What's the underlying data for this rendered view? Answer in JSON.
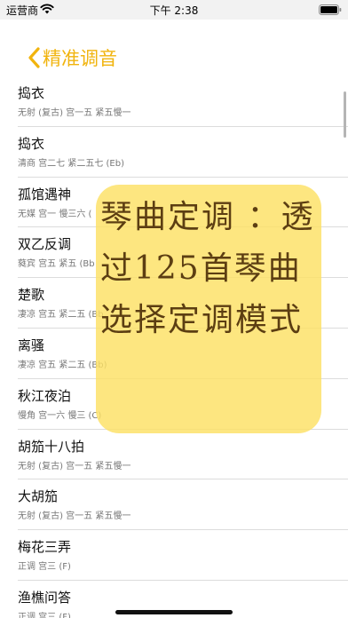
{
  "status_bar": {
    "carrier": "运营商",
    "time": "下午 2:38"
  },
  "nav": {
    "back_label": "精准调音"
  },
  "list": [
    {
      "title": "捣衣",
      "sub": "无射 (复古) 宫一五 紧五慢一"
    },
    {
      "title": "捣衣",
      "sub": "清商 宫二七 紧二五七 (Eb)"
    },
    {
      "title": "孤馆遇神",
      "sub": "无媒 宫一 慢三六 ("
    },
    {
      "title": "双乙反调",
      "sub": "蕤宾 宫五 紧五 (Bb"
    },
    {
      "title": "楚歌",
      "sub": "凄凉 宫五 紧二五 (Bb"
    },
    {
      "title": "离骚",
      "sub": "凄凉 宫五 紧二五 (Bb)"
    },
    {
      "title": "秋江夜泊",
      "sub": "慢角 宫一六 慢三 (C)"
    },
    {
      "title": "胡笳十八拍",
      "sub": "无射 (复古) 宫一五 紧五慢一"
    },
    {
      "title": "大胡笳",
      "sub": "无射 (复古) 宫一五 紧五慢一"
    },
    {
      "title": "梅花三弄",
      "sub": "正调 宫三 (F)"
    },
    {
      "title": "渔樵问答",
      "sub": "正调 宫三 (F)"
    }
  ],
  "promo": {
    "text": "琴曲定调 ：透过125首琴曲选择定调模式"
  },
  "colors": {
    "accent": "#f1b40e",
    "promo_bg": "#fce064",
    "promo_text": "#5c3e12"
  },
  "icons": {
    "back": "chevron-left-icon",
    "wifi": "wifi-icon",
    "battery": "battery-icon"
  }
}
